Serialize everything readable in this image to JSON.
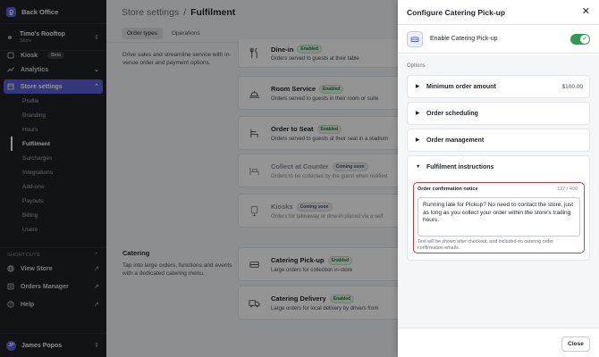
{
  "app": {
    "title": "Back Office"
  },
  "store": {
    "name": "Timo's Rooftop",
    "type": "Store"
  },
  "sidebar": {
    "kiosk": {
      "label": "Kiosk",
      "badge": "Beta"
    },
    "analytics": "Analytics",
    "store_settings": "Store settings",
    "sub_items": [
      "Profile",
      "Branding",
      "Hours",
      "Fulfilment",
      "Surcharges",
      "Integrations",
      "Add-ons",
      "Payouts",
      "Billing",
      "Users"
    ],
    "current_sub": "Fulfilment",
    "shortcuts_label": "SHORTCUTS",
    "shortcuts": [
      "View Store",
      "Orders Manager",
      "Help"
    ],
    "user": {
      "name": "James Popos",
      "initials": "JP"
    }
  },
  "main": {
    "breadcrumb": {
      "parent": "Store settings",
      "sep": "/",
      "current": "Fulfilment"
    },
    "tabs": [
      "Order types",
      "Operations"
    ],
    "active_tab": "Order types",
    "dine_in_desc": "Drive sales and streamline service with in-venue order and payment options.",
    "catering_title": "Catering",
    "catering_desc": "Tap into large orders, functions and events with a dedicated catering menu.",
    "cards": [
      {
        "title": "Dine-in",
        "badge": "Enabled",
        "desc": "Orders served to guests at their table"
      },
      {
        "title": "Room Service",
        "badge": "Enabled",
        "desc": "Orders served to guests in their room or suite"
      },
      {
        "title": "Order to Seat",
        "badge": "Enabled",
        "desc": "Orders served to guests at their seat in a stadium"
      },
      {
        "title": "Collect at Counter",
        "badge": "Coming soon",
        "desc": "Orders to be collected by the guest when notified"
      },
      {
        "title": "Kiosks",
        "badge": "Coming soon",
        "desc": "Orders for takeaway or dine-in placed via a self"
      },
      {
        "title": "Catering Pick-up",
        "badge": "Enabled",
        "desc": "Large orders for collection in-store"
      },
      {
        "title": "Catering Delivery",
        "badge": "Enabled",
        "desc": "Large orders for local delivery by drivers from"
      }
    ]
  },
  "drawer": {
    "title": "Configure Catering Pick-up",
    "enable_label": "Enable Catering Pick-up",
    "enabled": true,
    "options_label": "Options",
    "accordions": [
      {
        "label": "Minimum order amount",
        "value": "$100.00",
        "open": false
      },
      {
        "label": "Order scheduling",
        "value": "",
        "open": false
      },
      {
        "label": "Order management",
        "value": "",
        "open": false
      },
      {
        "label": "Fulfilment instructions",
        "value": "",
        "open": true
      }
    ],
    "field": {
      "label": "Order confirmation notice",
      "counter": "127 / 400",
      "value": "Running late for Pickup? No need to contact the store, just as long as you collect your order within the store's trading hours.",
      "hint": "Text will be shown after checkout, and included on catering order confirmation emails."
    },
    "close_label": "Close"
  },
  "colors": {
    "accent": "#5b5fd6",
    "success": "#2e9a53",
    "highlight": "#d63a3a"
  }
}
